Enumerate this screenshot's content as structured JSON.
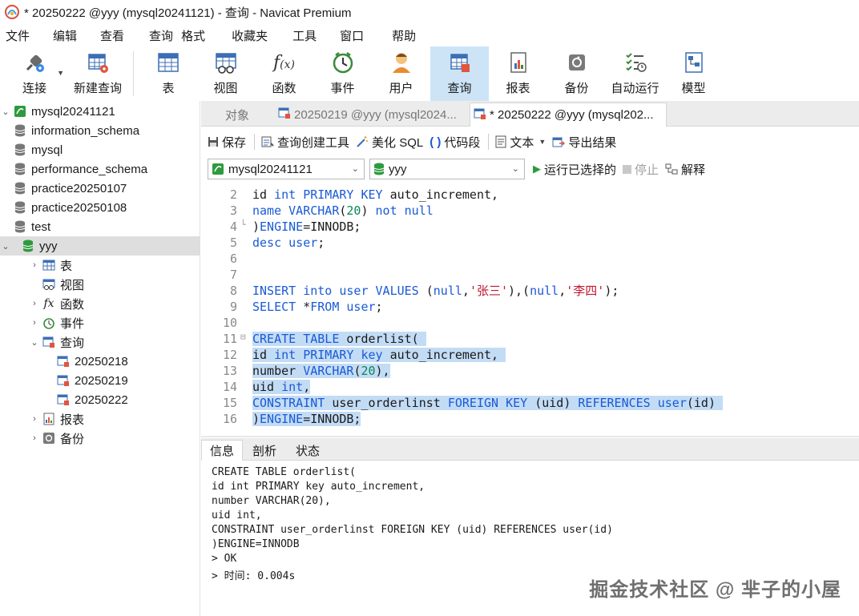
{
  "window": {
    "title": "* 20250222 @yyy (mysql20241121) - 查询 - Navicat Premium"
  },
  "menu": [
    "文件",
    "编辑",
    "查看",
    "查询",
    "格式",
    "收藏夹",
    "工具",
    "窗口",
    "帮助"
  ],
  "toolbar": {
    "connect": "连接",
    "new_query": "新建查询",
    "table": "表",
    "view": "视图",
    "function": "函数",
    "event": "事件",
    "user": "用户",
    "query": "查询",
    "report": "报表",
    "backup": "备份",
    "automation": "自动运行",
    "model": "模型"
  },
  "sidebar": {
    "connection": "mysql20241121",
    "databases": [
      "information_schema",
      "mysql",
      "performance_schema",
      "practice20250107",
      "practice20250108",
      "test"
    ],
    "current_db": "yyy",
    "nodes": {
      "tables": "表",
      "views": "视图",
      "functions": "函数",
      "events": "事件",
      "queries": "查询",
      "reports": "报表",
      "backups": "备份"
    },
    "queries": [
      "20250218",
      "20250219",
      "20250222"
    ]
  },
  "tabs": {
    "objects": "对象",
    "tab1": "20250219 @yyy (mysql2024...",
    "tab2": "* 20250222 @yyy (mysql202..."
  },
  "query_toolbar": {
    "save": "保存",
    "builder": "查询创建工具",
    "beautify": "美化 SQL",
    "snippet": "代码段",
    "text": "文本",
    "export": "导出结果"
  },
  "selectors": {
    "connection": "mysql20241121",
    "database": "yyy",
    "run_selected": "运行已选择的",
    "stop": "停止",
    "explain": "解释"
  },
  "editor": {
    "line_numbers": [
      "2",
      "3",
      "4",
      "5",
      "6",
      "7",
      "8",
      "9",
      "10",
      "11",
      "12",
      "13",
      "14",
      "15",
      "16"
    ]
  },
  "info": {
    "tabs": [
      "信息",
      "剖析",
      "状态"
    ],
    "lines": [
      "CREATE TABLE orderlist(",
      "id int PRIMARY key auto_increment,",
      "number VARCHAR(20),",
      "uid int,",
      "CONSTRAINT user_orderlinst FOREIGN KEY (uid) REFERENCES user(id)",
      ")ENGINE=INNODB",
      "> OK",
      "> 时间: 0.004s"
    ]
  },
  "watermark": "掘金技术社区 @ 芈子的小屋",
  "colors": {
    "keyword": "#1a5ad6",
    "string": "#c01830",
    "number": "#098658",
    "selection": "#c3dcf5",
    "active_tool": "#cde4f7"
  }
}
